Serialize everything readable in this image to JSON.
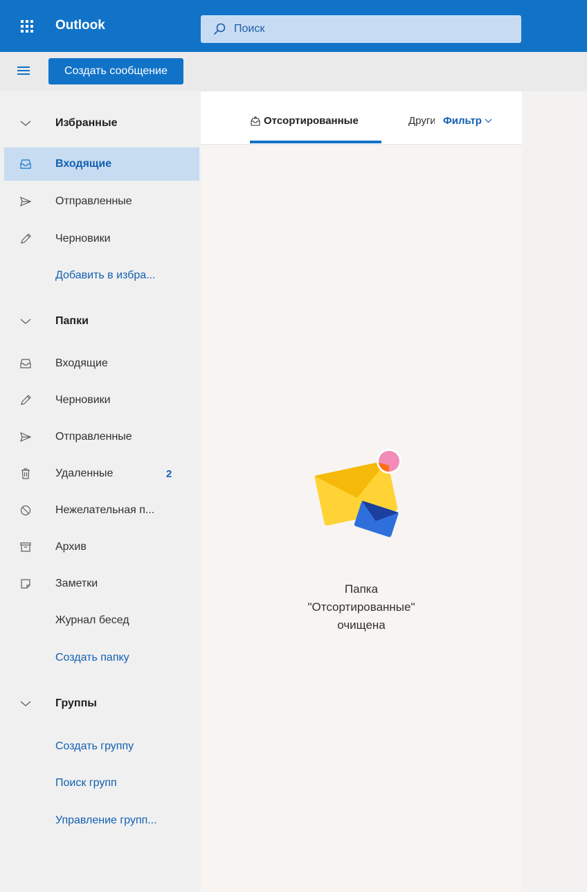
{
  "topbar": {
    "app_name": "Outlook",
    "search_placeholder": "Поиск",
    "waffle_icon": "app-launcher-icon",
    "accent_color": "#1173c8"
  },
  "commandbar": {
    "new_message_label": "Создать сообщение",
    "menu_icon": "hamburger-icon"
  },
  "sidebar": {
    "favorites_header": "Избранные",
    "favorites": [
      {
        "label": "Входящие",
        "icon": "inbox-icon",
        "active": true
      },
      {
        "label": "Отправленные",
        "icon": "send-icon"
      },
      {
        "label": "Черновики",
        "icon": "pencil-icon"
      }
    ],
    "add_favorite": "Добавить в избра...",
    "folders_header": "Папки",
    "folders": [
      {
        "label": "Входящие",
        "icon": "inbox-icon"
      },
      {
        "label": "Черновики",
        "icon": "pencil-icon"
      },
      {
        "label": "Отправленные",
        "icon": "send-icon"
      },
      {
        "label": "Удаленные",
        "icon": "trash-icon",
        "count": "2"
      },
      {
        "label": "Нежелательная п...",
        "icon": "block-icon"
      },
      {
        "label": "Архив",
        "icon": "archive-icon"
      },
      {
        "label": "Заметки",
        "icon": "note-icon"
      },
      {
        "label": "Журнал бесед",
        "icon": ""
      }
    ],
    "create_folder": "Создать папку",
    "groups_header": "Группы",
    "group_links": [
      "Создать группу",
      "Поиск групп",
      "Управление групп..."
    ]
  },
  "main": {
    "tab_focused": "Отсортированные",
    "tab_other": "Другие",
    "filter_label": "Фильтр",
    "empty_line1": "Папка",
    "empty_line2": "\"Отсортированные\"",
    "empty_line3": "очищена"
  }
}
